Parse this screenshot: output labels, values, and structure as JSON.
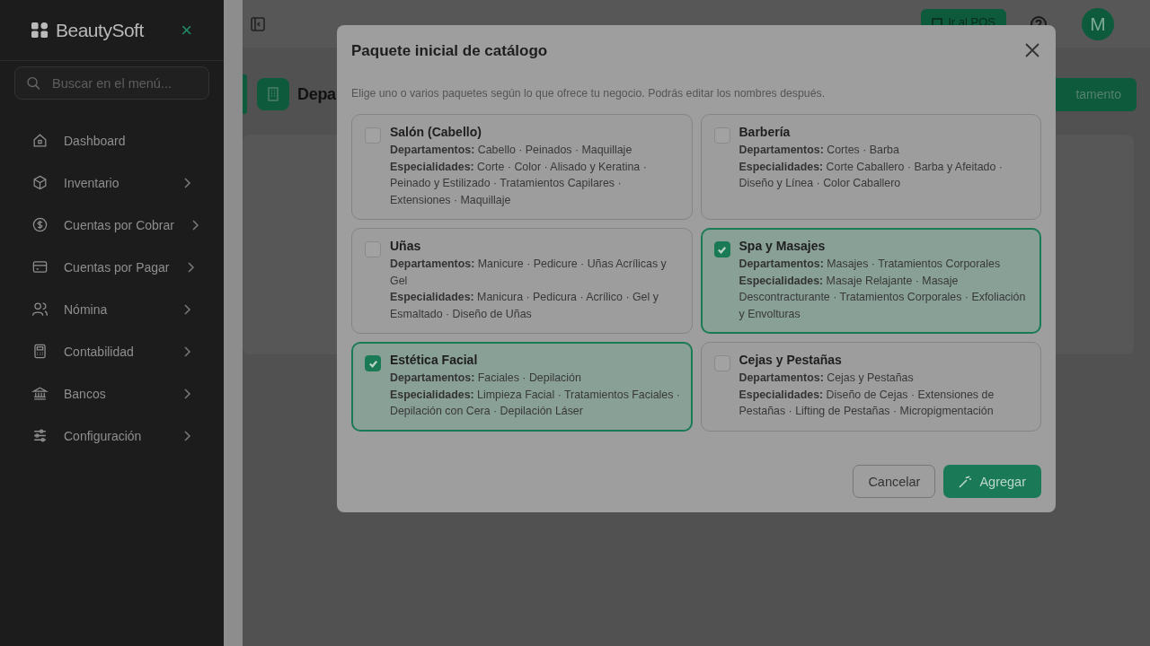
{
  "sidebar": {
    "brand": "BeautySoft",
    "close": "×",
    "search": {
      "placeholder": "Buscar en el menú..."
    },
    "items": [
      {
        "label": "Dashboard",
        "expandable": false
      },
      {
        "label": "Inventario",
        "expandable": true
      },
      {
        "label": "Cuentas por Cobrar",
        "expandable": true
      },
      {
        "label": "Cuentas por Pagar",
        "expandable": true
      },
      {
        "label": "Nómina",
        "expandable": true
      },
      {
        "label": "Contabilidad",
        "expandable": true
      },
      {
        "label": "Bancos",
        "expandable": true
      },
      {
        "label": "Configuración",
        "expandable": true
      }
    ]
  },
  "topbar": {
    "pos_button": "Ir al POS",
    "avatar": "M"
  },
  "page": {
    "title": "Depa",
    "action_button": "tamento"
  },
  "dialog": {
    "title": "Paquete inicial de catálogo",
    "description": "Elige uno o varios paquetes según lo que ofrece tu negocio. Podrás editar los nombres después.",
    "packages": [
      {
        "name": "Salón (Cabello)",
        "departments": "**Departamentos:** Cabello · Peinados · Maquillaje",
        "specialties": "**Especialidades:** Corte · Color · Alisado y Keratina · Peinado y Estilizado · Tratamientos Capilares · Extensiones · Maquillaje",
        "checked": false
      },
      {
        "name": "Barbería",
        "departments": "**Departamentos:** Cortes · Barba",
        "specialties": "**Especialidades:** Corte Caballero · Barba y Afeitado · Diseño y Línea · Color Caballero",
        "checked": false
      },
      {
        "name": "Uñas",
        "departments": "**Departamentos:** Manicure · Pedicure · Uñas Acrílicas y Gel",
        "specialties": "**Especialidades:** Manicura · Pedicura · Acrílico · Gel y Esmaltado · Diseño de Uñas",
        "checked": false
      },
      {
        "name": "Spa y Masajes",
        "departments": "**Departamentos:** Masajes · Tratamientos Corporales",
        "specialties": "**Especialidades:** Masaje Relajante · Masaje Descontracturante · Tratamientos Corporales · Exfoliación y Envolturas",
        "checked": true
      },
      {
        "name": "Estética Facial",
        "departments": "**Departamentos:** Faciales · Depilación",
        "specialties": "**Especialidades:** Limpieza Facial · Tratamientos Faciales · Depilación con Cera · Depilación Láser",
        "checked": true
      },
      {
        "name": "Cejas y Pestañas",
        "departments": "**Departamentos:** Cejas y Pestañas",
        "specialties": "**Especialidades:** Diseño de Cejas · Extensiones de Pestañas · Lifting de Pestañas · Micropigmentación",
        "checked": false
      }
    ],
    "cancel": "Cancelar",
    "submit": "Agregar"
  }
}
